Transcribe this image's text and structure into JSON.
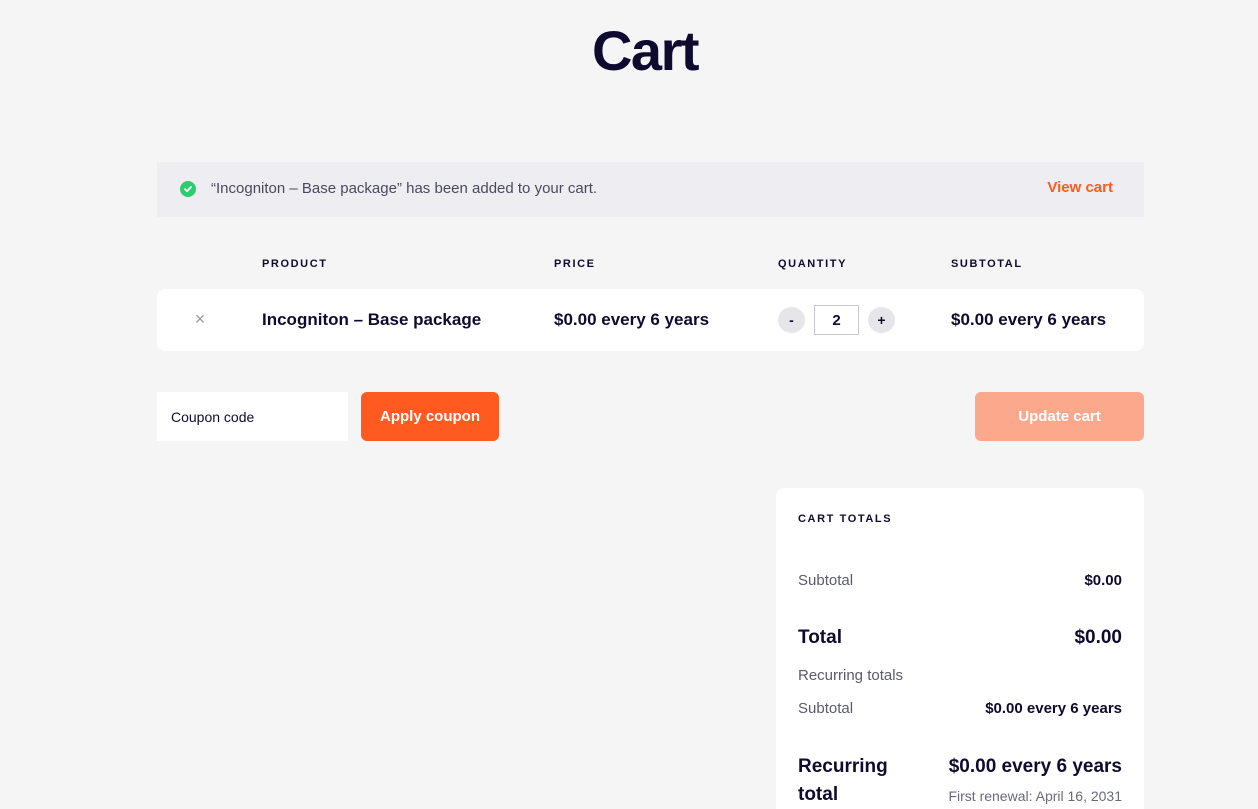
{
  "page": {
    "title": "Cart"
  },
  "notice": {
    "message": "“Incogniton – Base package” has been added to your cart.",
    "view_cart": "View cart",
    "icon": "check-circle-icon"
  },
  "table": {
    "headers": [
      "PRODUCT",
      "PRICE",
      "QUANTITY",
      "SUBTOTAL"
    ],
    "rows": [
      {
        "remove": "×",
        "product": "Incogniton – Base package",
        "price": "$0.00 every 6 years",
        "quantity": "2",
        "subtotal": "$0.00 every 6 years"
      }
    ],
    "qty_minus": "-",
    "qty_plus": "+"
  },
  "actions": {
    "coupon_placeholder": "Coupon code",
    "apply_coupon": "Apply coupon",
    "update_cart": "Update cart"
  },
  "totals": {
    "heading": "CART TOTALS",
    "subtotal_label": "Subtotal",
    "subtotal_value": "$0.00",
    "total_label": "Total",
    "total_value": "$0.00",
    "recurring_heading": "Recurring totals",
    "recurring_subtotal_label": "Subtotal",
    "recurring_subtotal_value": "$0.00 every 6 years",
    "recurring_total_label_1": "Recurring",
    "recurring_total_label_2": "total",
    "recurring_total_value": "$0.00 every 6 years",
    "first_renewal": "First renewal: April 16, 2031"
  },
  "colors": {
    "accent": "#ff5a1f",
    "accent_disabled": "#fca88c",
    "success": "#2ecc71",
    "text": "#0e0b2e",
    "background": "#f5f5f6"
  }
}
